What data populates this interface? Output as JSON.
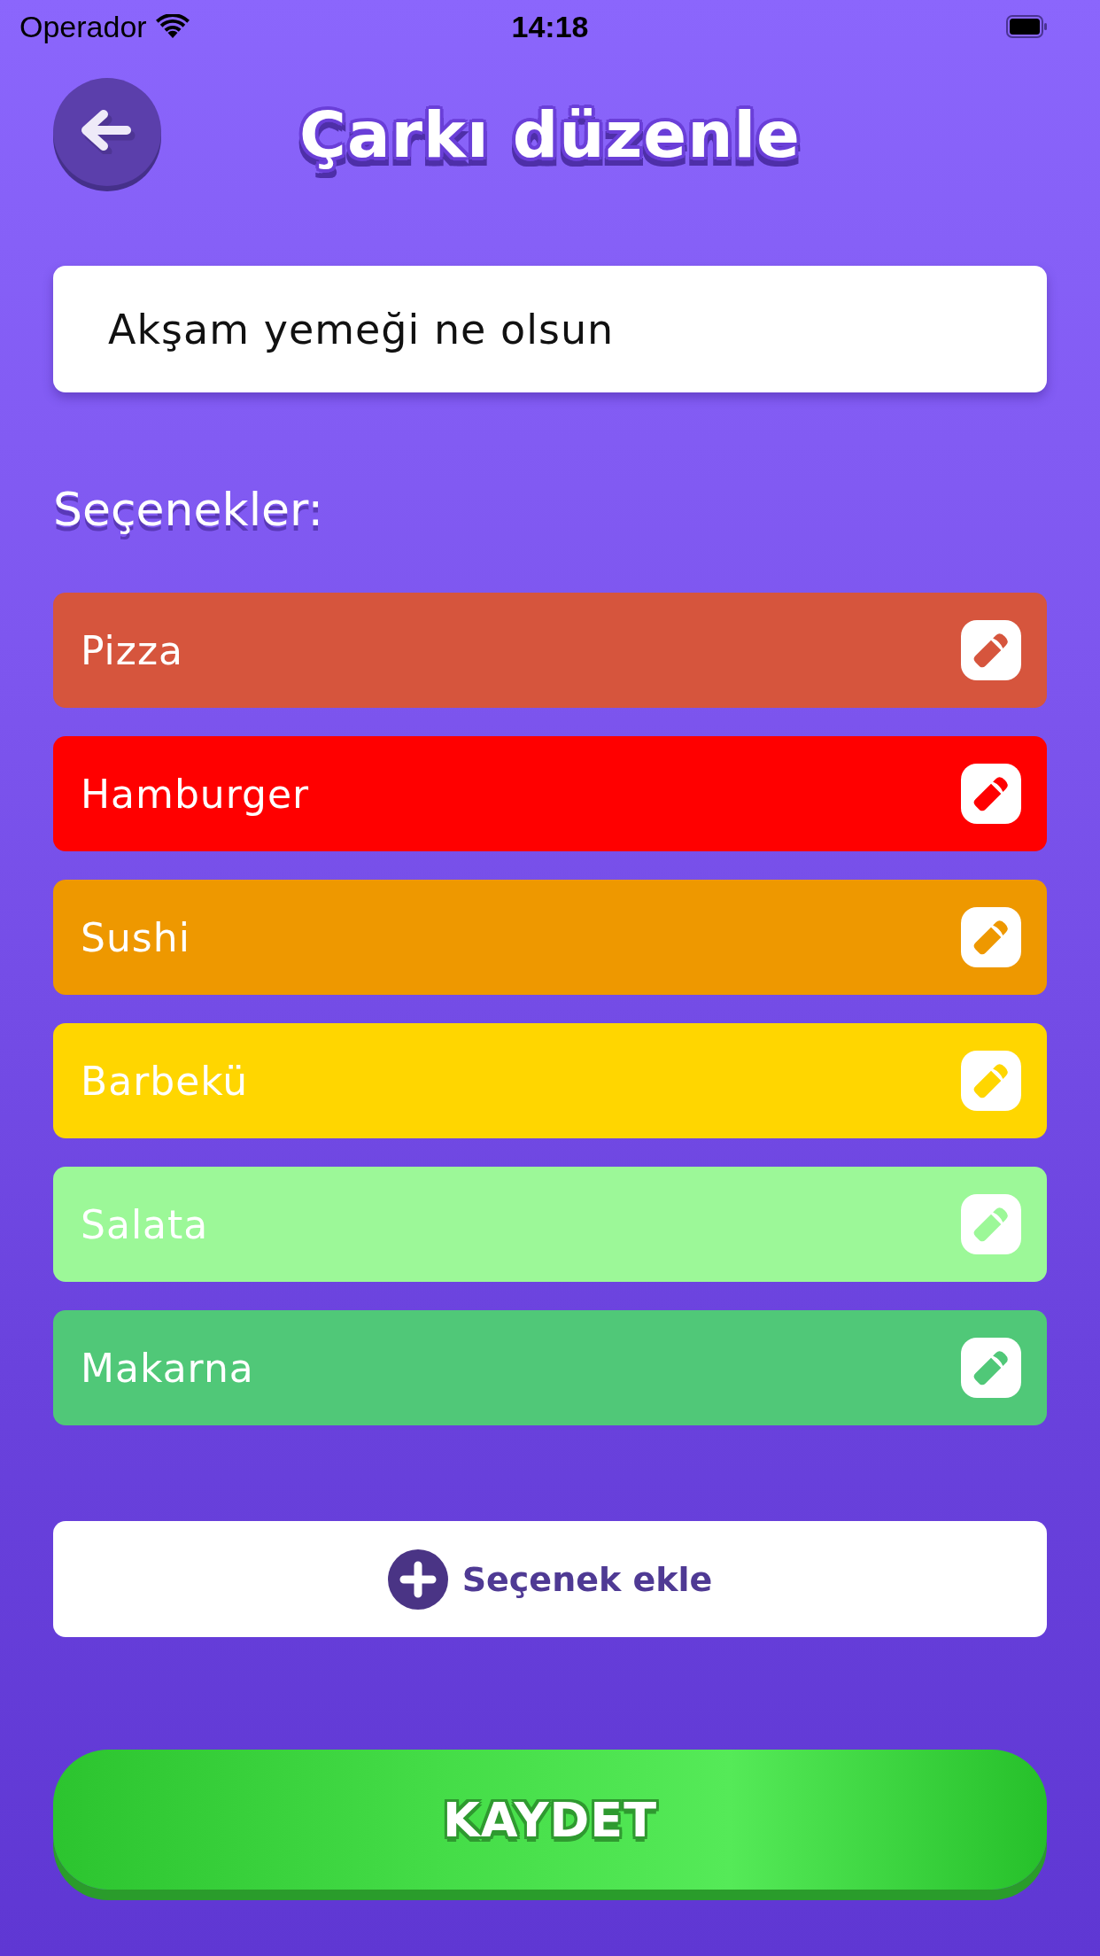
{
  "status_bar": {
    "carrier": "Operador",
    "time": "14:18"
  },
  "header": {
    "title": "Çarkı düzenle"
  },
  "wheel_name": {
    "value": "Akşam yemeği ne olsun"
  },
  "options_label": "Seçenekler:",
  "options": [
    {
      "label": "Pizza",
      "color": "#d6553d"
    },
    {
      "label": "Hamburger",
      "color": "#ff0000"
    },
    {
      "label": "Sushi",
      "color": "#ee9800"
    },
    {
      "label": "Barbekü",
      "color": "#ffd600"
    },
    {
      "label": "Salata",
      "color": "#9cf898"
    },
    {
      "label": "Makarna",
      "color": "#50c878"
    }
  ],
  "add_button": {
    "label": "Seçenek ekle"
  },
  "save_button": {
    "label": "KAYDET"
  }
}
